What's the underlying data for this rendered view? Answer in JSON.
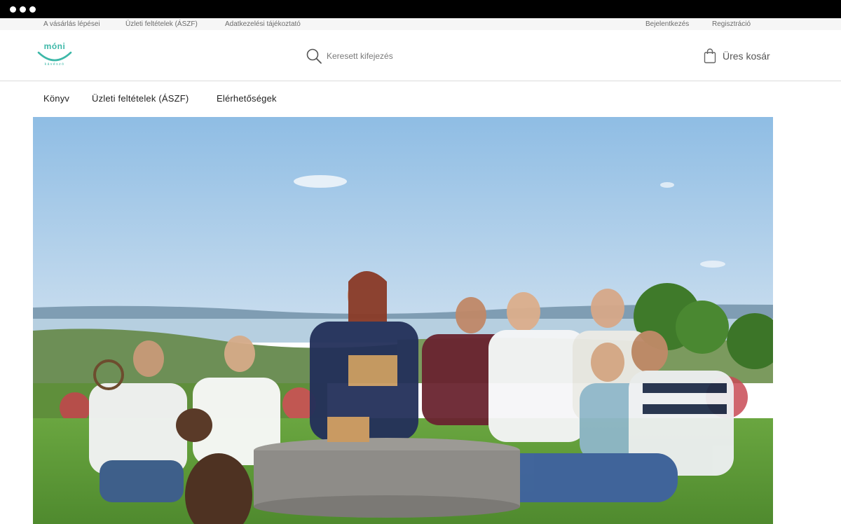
{
  "topbar": {
    "left_links": [
      "A vásárlás lépései",
      "Üzleti feltételek (ÁSZF)",
      "Adatkezelési tájékoztató"
    ],
    "login": "Bejelentkezés",
    "register": "Regisztráció"
  },
  "header": {
    "logo_text": "móni",
    "logo_subtext": "kávészó",
    "search_placeholder": "Keresett kifejezés",
    "search_icon": "search-icon",
    "cart_icon": "shopping-bag-icon",
    "cart_label": "Üres kosár"
  },
  "nav": {
    "items": [
      "Könyv",
      "Üzleti feltételek (ÁSZF)",
      "Elérhetőségek"
    ]
  },
  "colors": {
    "brand": "#3db8a8",
    "sky": "#9cc3e6",
    "grass": "#5a9a3a"
  }
}
